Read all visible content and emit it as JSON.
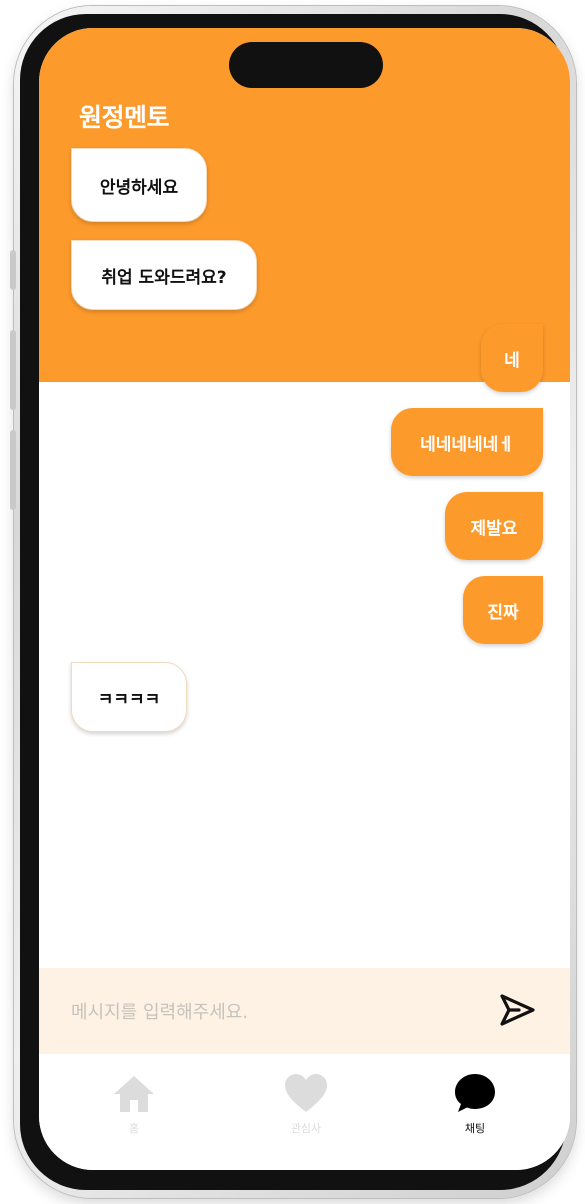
{
  "app": {
    "title": "원정멘토"
  },
  "messages": [
    {
      "side": "received",
      "text": "안녕하세요"
    },
    {
      "side": "received",
      "text": "취업 도와드려요?"
    },
    {
      "side": "sent",
      "text": "네"
    },
    {
      "side": "sent",
      "text": "네네네네네ㅔ"
    },
    {
      "side": "sent",
      "text": "제발요"
    },
    {
      "side": "sent",
      "text": "진짜"
    },
    {
      "side": "received",
      "text": "ㅋㅋㅋㅋ"
    }
  ],
  "input": {
    "placeholder": "메시지를 입력해주세요.",
    "value": ""
  },
  "send": {
    "icon": "send-icon"
  },
  "tabs": [
    {
      "label": "홈",
      "icon": "home-icon",
      "active": false
    },
    {
      "label": "관심사",
      "icon": "heart-icon",
      "active": false
    },
    {
      "label": "채팅",
      "icon": "chat-bubble-icon",
      "active": true
    }
  ],
  "colors": {
    "accent": "#fd9a2c",
    "input_bg": "#fef2e4",
    "inactive_icon": "#dcdcdc"
  }
}
